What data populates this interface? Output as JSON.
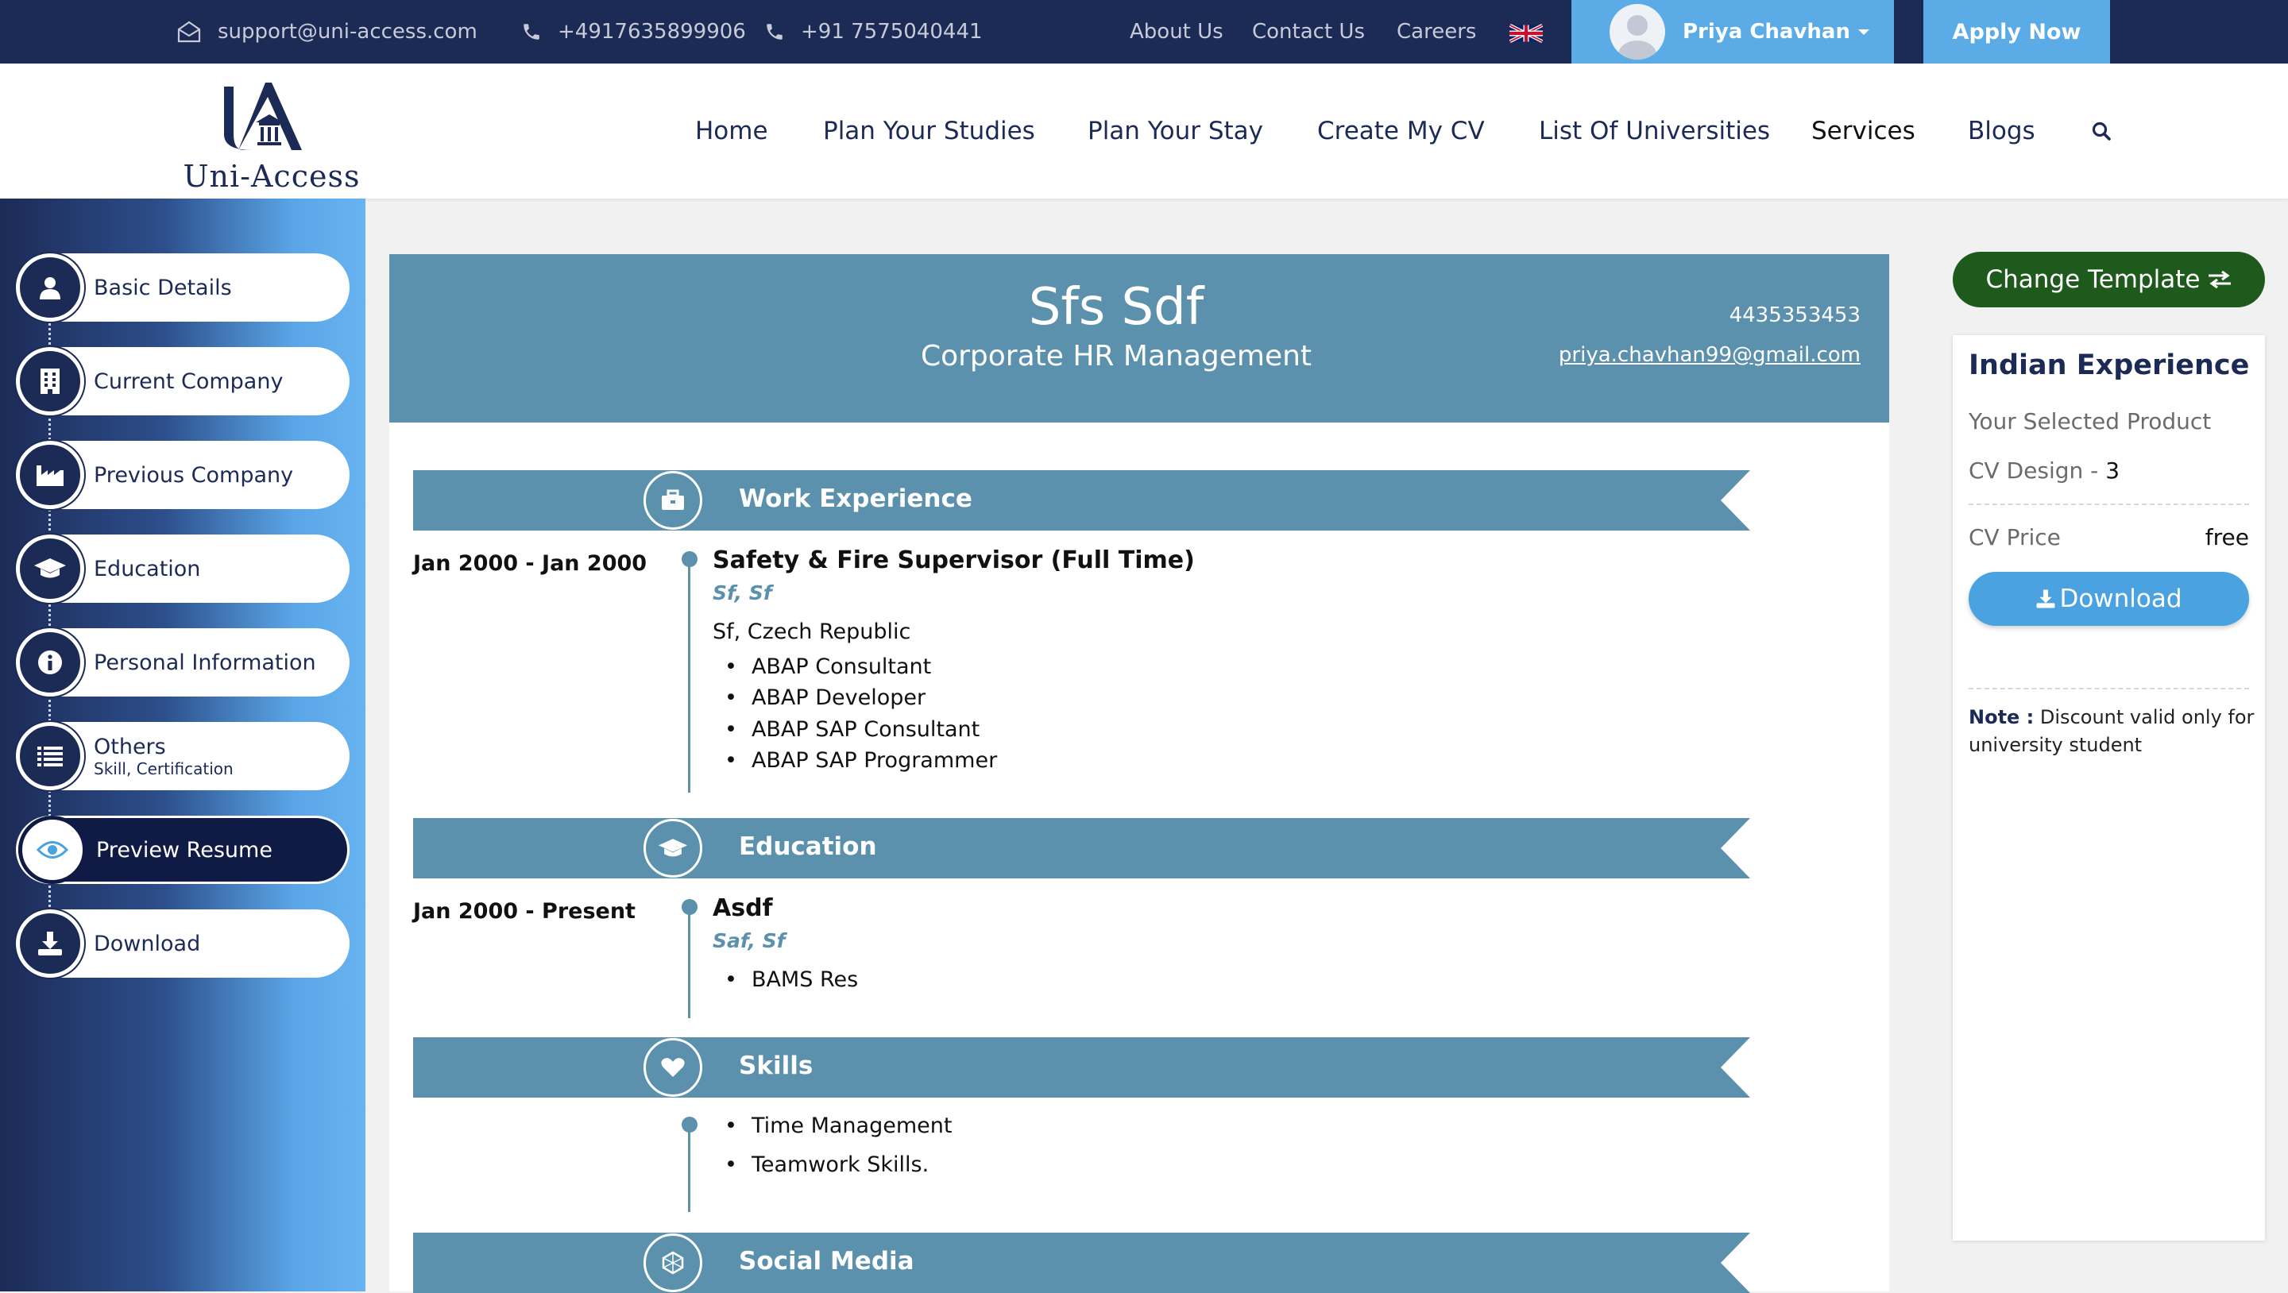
{
  "topbar": {
    "email": "support@uni-access.com",
    "phone1": "+4917635899906",
    "phone2": "+91 7575040441",
    "links": [
      "About Us",
      "Contact Us",
      "Careers"
    ],
    "user_name": "Priya Chavhan",
    "apply_label": "Apply Now"
  },
  "nav": {
    "logo_text": "Uni-Access",
    "items": [
      "Home",
      "Plan Your Studies",
      "Plan Your Stay",
      "Create My CV",
      "List Of Universities",
      "Services",
      "Blogs"
    ]
  },
  "sidebar": {
    "steps": [
      {
        "label": "Basic Details"
      },
      {
        "label": "Current Company"
      },
      {
        "label": "Previous Company"
      },
      {
        "label": "Education"
      },
      {
        "label": "Personal Information"
      },
      {
        "label": "Others",
        "sub": "Skill, Certification"
      },
      {
        "label": "Preview Resume"
      },
      {
        "label": "Download"
      }
    ]
  },
  "resume": {
    "name": "Sfs Sdf",
    "title": "Corporate HR Management",
    "phone": "4435353453",
    "email": "priya.chavhan99@gmail.com",
    "work": {
      "heading": "Work Experience",
      "date": "Jan 2000 - Jan 2000",
      "role": "Safety & Fire Supervisor (Full Time)",
      "company": "Sf, Sf",
      "location": "Sf, Czech Republic",
      "bullets": [
        "ABAP Consultant",
        "ABAP Developer",
        "ABAP SAP Consultant",
        "ABAP SAP Programmer"
      ]
    },
    "education": {
      "heading": "Education",
      "date": "Jan 2000 - Present",
      "degree": "Asdf",
      "school": "Saf, Sf",
      "bullets": [
        "BAMS Res"
      ]
    },
    "skills": {
      "heading": "Skills",
      "bullets": [
        "Time Management",
        "Teamwork Skills."
      ]
    },
    "social": {
      "heading": "Social Media"
    }
  },
  "panel": {
    "change_template": "Change Template",
    "title": "Indian Experience",
    "selected_product": "Your Selected Product",
    "cv_design_label": "CV Design - ",
    "cv_design_value": "3",
    "price_label": "CV Price",
    "price_value": "free",
    "download": "Download",
    "note_label": "Note :",
    "note_text": " Discount valid only for university student"
  },
  "colors": {
    "navy": "#1c2a56",
    "accent": "#5aabe6",
    "resume_band": "#5b91ad",
    "change_template_green": "#1f5a1d"
  }
}
